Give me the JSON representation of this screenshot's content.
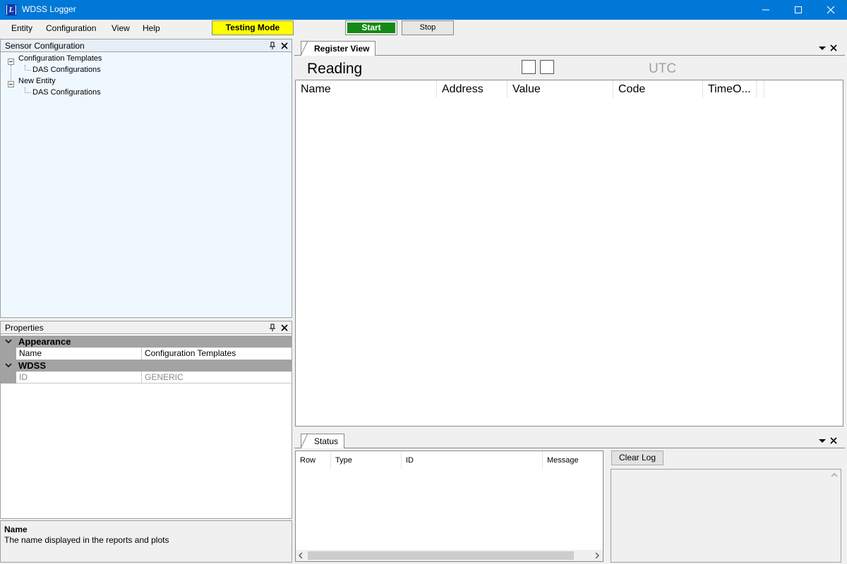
{
  "window": {
    "title": "WDSS Logger",
    "icon_letter": "L"
  },
  "menu": {
    "items": [
      "Entity",
      "Configuration",
      "View",
      "Help"
    ]
  },
  "toolbar": {
    "testing_mode": "Testing Mode",
    "start": "Start",
    "stop": "Stop"
  },
  "sensor_pane": {
    "title": "Sensor Configuration",
    "tree": [
      {
        "label": "Configuration Templates",
        "children": [
          "DAS Configurations"
        ]
      },
      {
        "label": "New Entity",
        "children": [
          "DAS Configurations"
        ]
      }
    ]
  },
  "properties": {
    "title": "Properties",
    "categories": [
      {
        "name": "Appearance",
        "rows": [
          {
            "name": "Name",
            "value": "Configuration Templates"
          }
        ]
      },
      {
        "name": "WDSS",
        "rows": [
          {
            "name": "ID",
            "value": "GENERIC"
          }
        ]
      }
    ],
    "description": {
      "title": "Name",
      "text": "The name displayed in the reports and plots"
    }
  },
  "register_view": {
    "tab": "Register View",
    "reading_label": "Reading",
    "utc_label": "UTC",
    "columns": [
      "Name",
      "Address",
      "Value",
      "Code",
      "TimeO..."
    ]
  },
  "status": {
    "tab": "Status",
    "columns": [
      "Row",
      "Type",
      "ID",
      "Message"
    ],
    "clear_log": "Clear Log"
  },
  "colors": {
    "titlebar": "#0078d7",
    "testing_mode_bg": "#ffff00",
    "start_bg": "#138a13",
    "tree_bg": "#f0f8ff",
    "category_bg": "#a3a3a3"
  }
}
